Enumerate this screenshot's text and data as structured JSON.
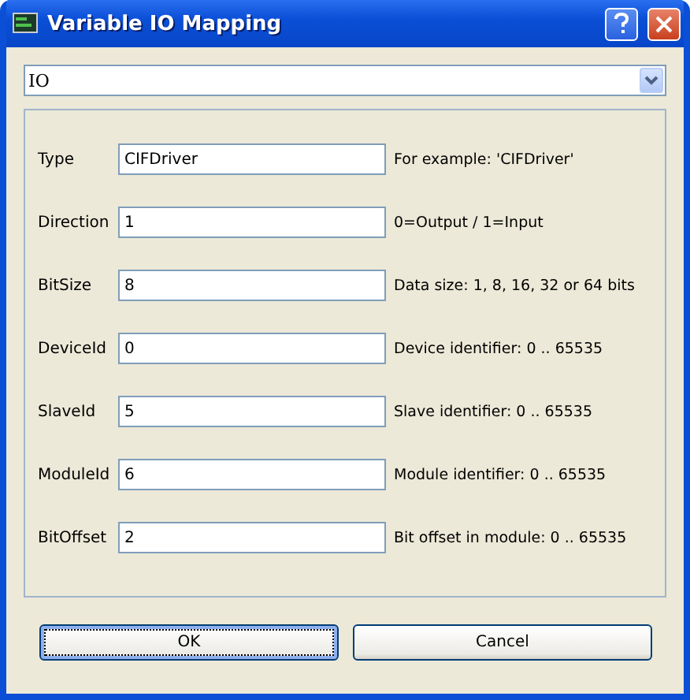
{
  "window": {
    "title": "Variable IO Mapping"
  },
  "combo": {
    "value": "IO"
  },
  "fields": [
    {
      "label": "Type",
      "value": "CIFDriver",
      "hint": "For example: 'CIFDriver'"
    },
    {
      "label": "Direction",
      "value": "1",
      "hint": "0=Output / 1=Input"
    },
    {
      "label": "BitSize",
      "value": "8",
      "hint": "Data size: 1, 8, 16, 32 or 64 bits"
    },
    {
      "label": "DeviceId",
      "value": "0",
      "hint": "Device identifier: 0 .. 65535"
    },
    {
      "label": "SlaveId",
      "value": "5",
      "hint": "Slave identifier: 0 .. 65535"
    },
    {
      "label": "ModuleId",
      "value": "6",
      "hint": "Module identifier: 0 .. 65535"
    },
    {
      "label": "BitOffset",
      "value": "2",
      "hint": "Bit offset in module: 0 .. 65535"
    }
  ],
  "buttons": [
    {
      "label": "OK",
      "focused": true
    },
    {
      "label": "Cancel",
      "focused": false
    }
  ]
}
